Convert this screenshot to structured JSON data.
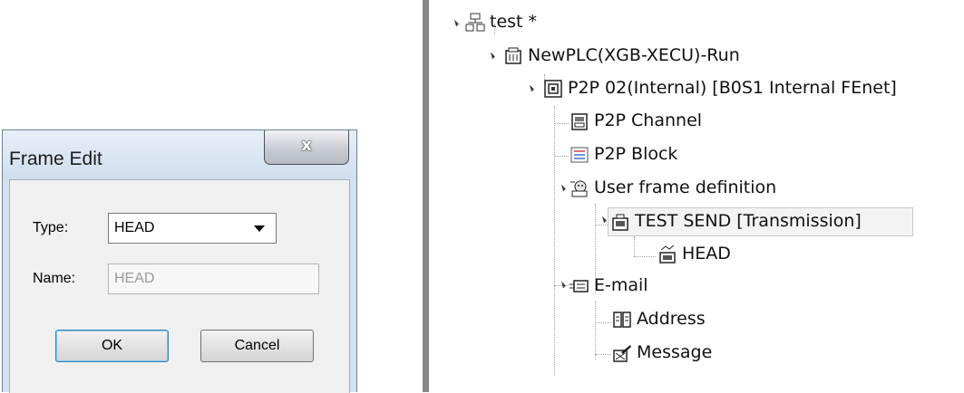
{
  "dialog": {
    "title": "Frame Edit",
    "close_glyph": "x",
    "type_label": "Type:",
    "type_value": "HEAD",
    "name_label": "Name:",
    "name_value": "HEAD",
    "ok_label": "OK",
    "cancel_label": "Cancel"
  },
  "tree": {
    "nodes": [
      {
        "label": "test *",
        "icon": "project-icon"
      },
      {
        "label": "NewPLC(XGB-XECU)-Run",
        "icon": "plc-icon"
      },
      {
        "label": "P2P 02(Internal) [B0S1 Internal FEnet]",
        "icon": "module-icon"
      },
      {
        "label": "P2P Channel",
        "icon": "channel-icon"
      },
      {
        "label": "P2P Block",
        "icon": "block-icon"
      },
      {
        "label": "User frame definition",
        "icon": "frame-definition-icon"
      },
      {
        "label": "TEST SEND [Transmission]",
        "icon": "transmission-icon"
      },
      {
        "label": "HEAD",
        "icon": "head-frame-icon"
      },
      {
        "label": "E-mail",
        "icon": "email-icon"
      },
      {
        "label": "Address",
        "icon": "address-book-icon"
      },
      {
        "label": "Message",
        "icon": "message-icon"
      }
    ]
  }
}
